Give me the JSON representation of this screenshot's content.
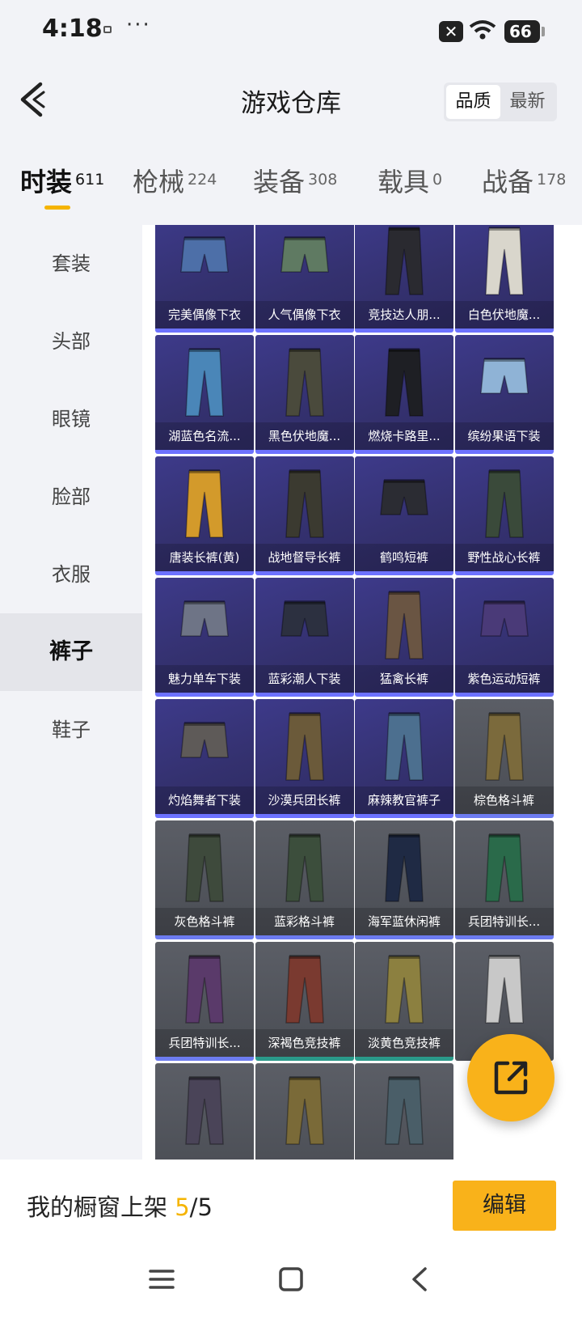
{
  "status_bar": {
    "time": "4:18",
    "dots": "···",
    "battery": "66"
  },
  "header": {
    "title": "游戏仓库",
    "sort_options": [
      "品质",
      "最新"
    ],
    "sort_active": 0
  },
  "categories": [
    {
      "label": "时装",
      "count": "611",
      "active": true
    },
    {
      "label": "枪械",
      "count": "224",
      "active": false
    },
    {
      "label": "装备",
      "count": "308",
      "active": false
    },
    {
      "label": "载具",
      "count": "0",
      "active": false
    },
    {
      "label": "战备",
      "count": "178",
      "active": false
    }
  ],
  "sidebar": {
    "items": [
      "套装",
      "头部",
      "眼镜",
      "脸部",
      "衣服",
      "裤子",
      "鞋子"
    ],
    "active_index": 5
  },
  "items": [
    {
      "name": "完美偶像下衣",
      "quality": "purple",
      "color": "#4d6fa8"
    },
    {
      "name": "人气偶像下衣",
      "quality": "purple",
      "color": "#5f7a62"
    },
    {
      "name": "竞技达人朋...",
      "quality": "purple",
      "color": "#2a2a30"
    },
    {
      "name": "白色伏地魔...",
      "quality": "purple",
      "color": "#d9d6cc"
    },
    {
      "name": "湖蓝色名流...",
      "quality": "purple",
      "color": "#4a86b8"
    },
    {
      "name": "黑色伏地魔...",
      "quality": "purple",
      "color": "#4a4a3c"
    },
    {
      "name": "燃烧卡路里...",
      "quality": "purple",
      "color": "#1e1f24"
    },
    {
      "name": "缤纷果语下装",
      "quality": "purple",
      "color": "#8fb3d6"
    },
    {
      "name": "唐装长裤(黄)",
      "quality": "purple",
      "color": "#d39a2b"
    },
    {
      "name": "战地督导长裤",
      "quality": "purple",
      "color": "#3b3a30"
    },
    {
      "name": "鹤鸣短裤",
      "quality": "purple",
      "color": "#2b2c33"
    },
    {
      "name": "野性战心长裤",
      "quality": "purple",
      "color": "#3a4a3a"
    },
    {
      "name": "魅力单车下装",
      "quality": "purple",
      "color": "#6e7486"
    },
    {
      "name": "蓝彩潮人下装",
      "quality": "purple",
      "color": "#2c3040"
    },
    {
      "name": "猛禽长裤",
      "quality": "purple",
      "color": "#6a5543"
    },
    {
      "name": "紫色运动短裤",
      "quality": "purple",
      "color": "#4a3a78"
    },
    {
      "name": "灼焰舞者下装",
      "quality": "purple",
      "color": "#5e5a58"
    },
    {
      "name": "沙漠兵团长裤",
      "quality": "purple",
      "color": "#6b5a3a"
    },
    {
      "name": "麻辣教官裤子",
      "quality": "purple",
      "color": "#4c6f8f"
    },
    {
      "name": "棕色格斗裤",
      "quality": "gray",
      "color": "#7b6a3c"
    },
    {
      "name": "灰色格斗裤",
      "quality": "gray",
      "color": "#3e4a3c"
    },
    {
      "name": "蓝彩格斗裤",
      "quality": "gray",
      "color": "#3c4e3c"
    },
    {
      "name": "海军蓝休闲裤",
      "quality": "gray",
      "color": "#1f2a44"
    },
    {
      "name": "兵团特训长...",
      "quality": "gray",
      "color": "#2a6a4a"
    },
    {
      "name": "兵团特训长...",
      "quality": "gray",
      "color": "#5a3a6a"
    },
    {
      "name": "深褐色竞技裤",
      "quality": "gray-teal",
      "color": "#7a3a30"
    },
    {
      "name": "淡黄色竞技裤",
      "quality": "gray-teal",
      "color": "#8c8040"
    },
    {
      "name": "",
      "quality": "gray-teal",
      "color": "#c8c8c8"
    },
    {
      "name": "",
      "quality": "gray",
      "color": "#4a4458"
    },
    {
      "name": "",
      "quality": "gray",
      "color": "#7a6a38"
    },
    {
      "name": "",
      "quality": "gray",
      "color": "#4a5e68"
    }
  ],
  "bottom_bar": {
    "showcase_label": "我的橱窗上架 ",
    "showcase_current": "5",
    "showcase_total": "/5",
    "edit_label": "编辑"
  }
}
